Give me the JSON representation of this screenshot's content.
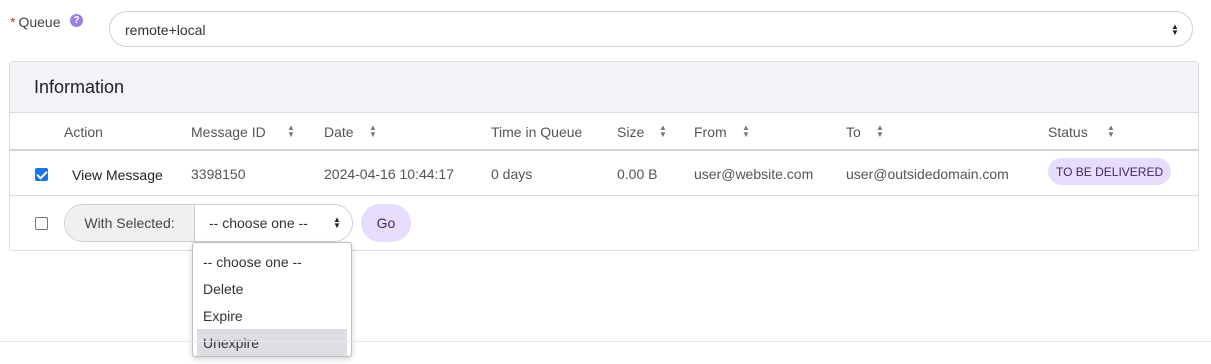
{
  "queue": {
    "required_mark": "*",
    "label": "Queue",
    "help_glyph": "?",
    "value": "remote+local"
  },
  "panel": {
    "title": "Information",
    "columns": [
      "Action",
      "Message ID",
      "Date",
      "Time in Queue",
      "Size",
      "From",
      "To",
      "Status"
    ],
    "rows": [
      {
        "checked": true,
        "action": "View Message",
        "message_id": "3398150",
        "date": "2024-04-16 10:44:17",
        "time_in_queue": "0 days",
        "size": "0.00 B",
        "from": "user@website.com",
        "to": "user@outsidedomain.com",
        "status": "TO BE DELIVERED"
      }
    ]
  },
  "bulk": {
    "with_selected_label": "With Selected:",
    "selected_value": "-- choose one --",
    "go_label": "Go",
    "options": [
      "-- choose one --",
      "Delete",
      "Expire",
      "Unexpire"
    ],
    "highlighted_option": "Unexpire"
  },
  "colors": {
    "accent_soft": "#e6dcfb",
    "checkbox_blue": "#1a73e8",
    "help_purple": "#9b7fe6",
    "required_red": "#c0392b"
  }
}
